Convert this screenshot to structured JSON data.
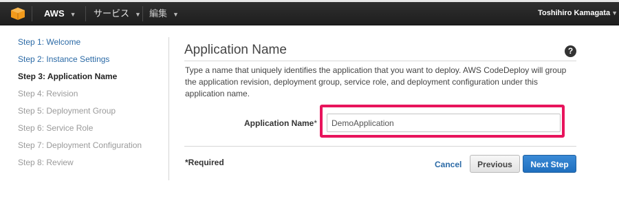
{
  "nav": {
    "aws_label": "AWS",
    "services_label": "サービス",
    "edit_label": "編集",
    "user_name": "Toshihiro Kamagata"
  },
  "steps": [
    {
      "label": "Step 1: Welcome",
      "state": "done"
    },
    {
      "label": "Step 2: Instance Settings",
      "state": "done"
    },
    {
      "label": "Step 3: Application Name",
      "state": "current"
    },
    {
      "label": "Step 4: Revision",
      "state": "todo"
    },
    {
      "label": "Step 5: Deployment Group",
      "state": "todo"
    },
    {
      "label": "Step 6: Service Role",
      "state": "todo"
    },
    {
      "label": "Step 7: Deployment Configuration",
      "state": "todo"
    },
    {
      "label": "Step 8: Review",
      "state": "todo"
    }
  ],
  "main": {
    "title": "Application Name",
    "help_glyph": "?",
    "description": "Type a name that uniquely identifies the application that you want to deploy. AWS CodeDeploy will group the application revision, deployment group, service role, and deployment configuration under this application name.",
    "field_label": "Application Name",
    "field_required_mark": "*",
    "field_value": "DemoApplication",
    "required_note": "*Required"
  },
  "buttons": {
    "cancel": "Cancel",
    "previous": "Previous",
    "next": "Next Step"
  },
  "colors": {
    "highlight": "#e8145c",
    "link": "#2b6aa6",
    "primary": "#1f6fbf",
    "logo": "#f29a1b"
  }
}
